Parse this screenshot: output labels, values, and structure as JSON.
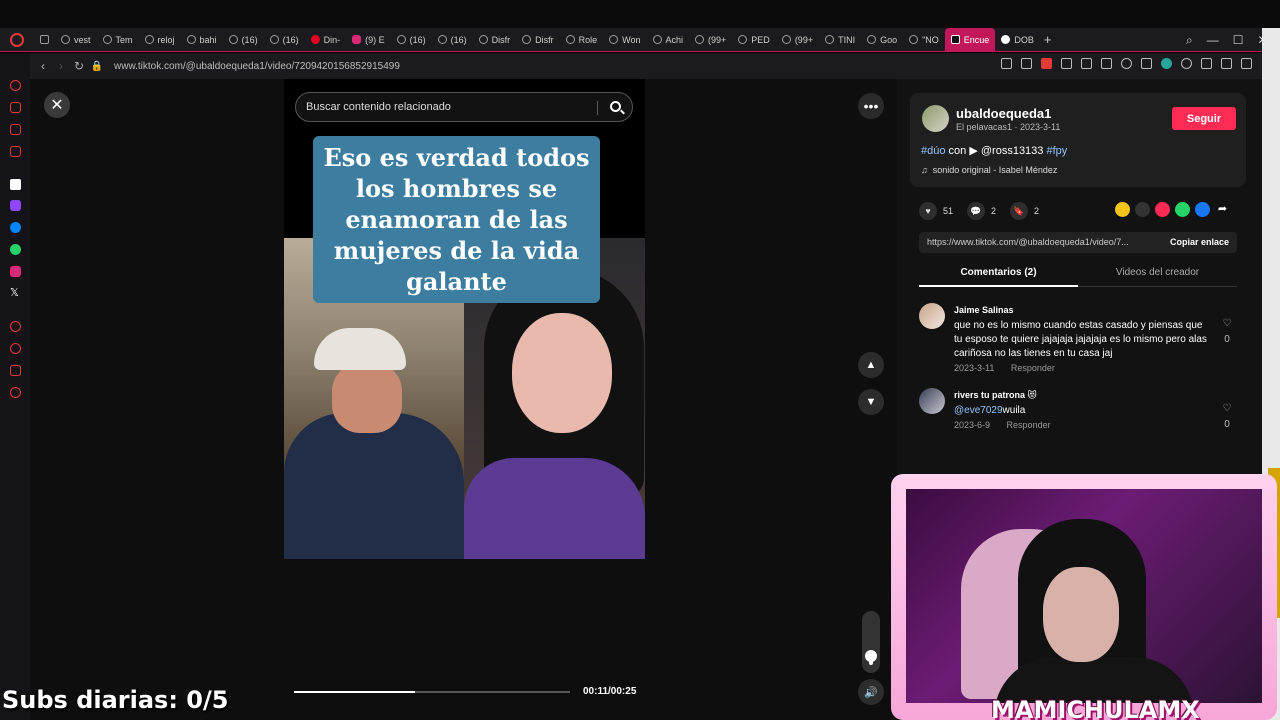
{
  "browser": {
    "tabs": [
      {
        "label": "vest",
        "icon": "globe-icon"
      },
      {
        "label": "Tem",
        "icon": "globe-icon"
      },
      {
        "label": "reloj",
        "icon": "globe-icon"
      },
      {
        "label": "bahi",
        "icon": "globe-icon"
      },
      {
        "label": "(16)",
        "icon": "globe-icon"
      },
      {
        "label": "(16)",
        "icon": "globe-icon"
      },
      {
        "label": "Din-",
        "icon": "pinterest-icon"
      },
      {
        "label": "(9) E",
        "icon": "instagram-icon"
      },
      {
        "label": "(16)",
        "icon": "globe-icon"
      },
      {
        "label": "(16)",
        "icon": "globe-icon"
      },
      {
        "label": "Disfr",
        "icon": "globe-icon"
      },
      {
        "label": "Disfr",
        "icon": "globe-icon"
      },
      {
        "label": "Role",
        "icon": "globe-icon"
      },
      {
        "label": "Won",
        "icon": "globe-icon"
      },
      {
        "label": "Achi",
        "icon": "globe-icon"
      },
      {
        "label": "(99+",
        "icon": "globe-icon"
      },
      {
        "label": "PED",
        "icon": "globe-icon"
      },
      {
        "label": "(99+",
        "icon": "globe-icon"
      },
      {
        "label": "TINI",
        "icon": "globe-icon"
      },
      {
        "label": "Goo",
        "icon": "globe-icon"
      },
      {
        "label": "\"NO",
        "icon": "globe-icon"
      },
      {
        "label": "Encue",
        "icon": "tiktok-icon",
        "active": true
      },
      {
        "label": "DOB",
        "icon": "google-icon"
      }
    ],
    "url": "www.tiktok.com/@ubaldoequeda1/video/7209420156852915499"
  },
  "viewer": {
    "search_placeholder": "Buscar contenido relacionado",
    "caption": "Eso es verdad todos los hombres se enamoran de las mujeres de la vida galante",
    "time": "00:11/00:25",
    "progress": 0.44,
    "volume": 0.2
  },
  "creator": {
    "username": "ubaldoequeda1",
    "subline": "El pelavacas1 · 2023-3-11",
    "follow_label": "Seguir",
    "desc_tag1": "#dúo",
    "desc_con": "con",
    "desc_mention": "@ross13133",
    "desc_tag2": "#fpy",
    "music": "sonido original - Isabel Méndez"
  },
  "stats": {
    "likes": "51",
    "comments": "2",
    "saves": "2"
  },
  "share": {
    "link": "https://www.tiktok.com/@ubaldoequeda1/video/7...",
    "copy_label": "Copiar enlace"
  },
  "panel_tabs": {
    "comments": "Comentarios (2)",
    "creator_videos": "Videos del creador"
  },
  "comments": [
    {
      "author": "Jaime Salinas",
      "text": "que no es lo mismo cuando estas casado y piensas que tu esposo te quiere jajajaja jajajaja es lo mismo pero alas cariñosa no las tienes en tu casa jaj",
      "date": "2023-3-11",
      "reply": "Responder",
      "likes": "0"
    },
    {
      "author": "rivers tu patrona 😻",
      "mention": "@eve7029",
      "text": "wuila",
      "date": "2023-6-9",
      "reply": "Responder",
      "likes": "0"
    }
  ],
  "overlay": {
    "subs": "Subs diarias: 0/5",
    "streamer": "MAMICHULAMX"
  },
  "colors": {
    "accent": "#fe2c55",
    "tab_active": "#c2185b",
    "caption_bg": "#3c7da0",
    "hashtag": "#8fc7ff"
  }
}
